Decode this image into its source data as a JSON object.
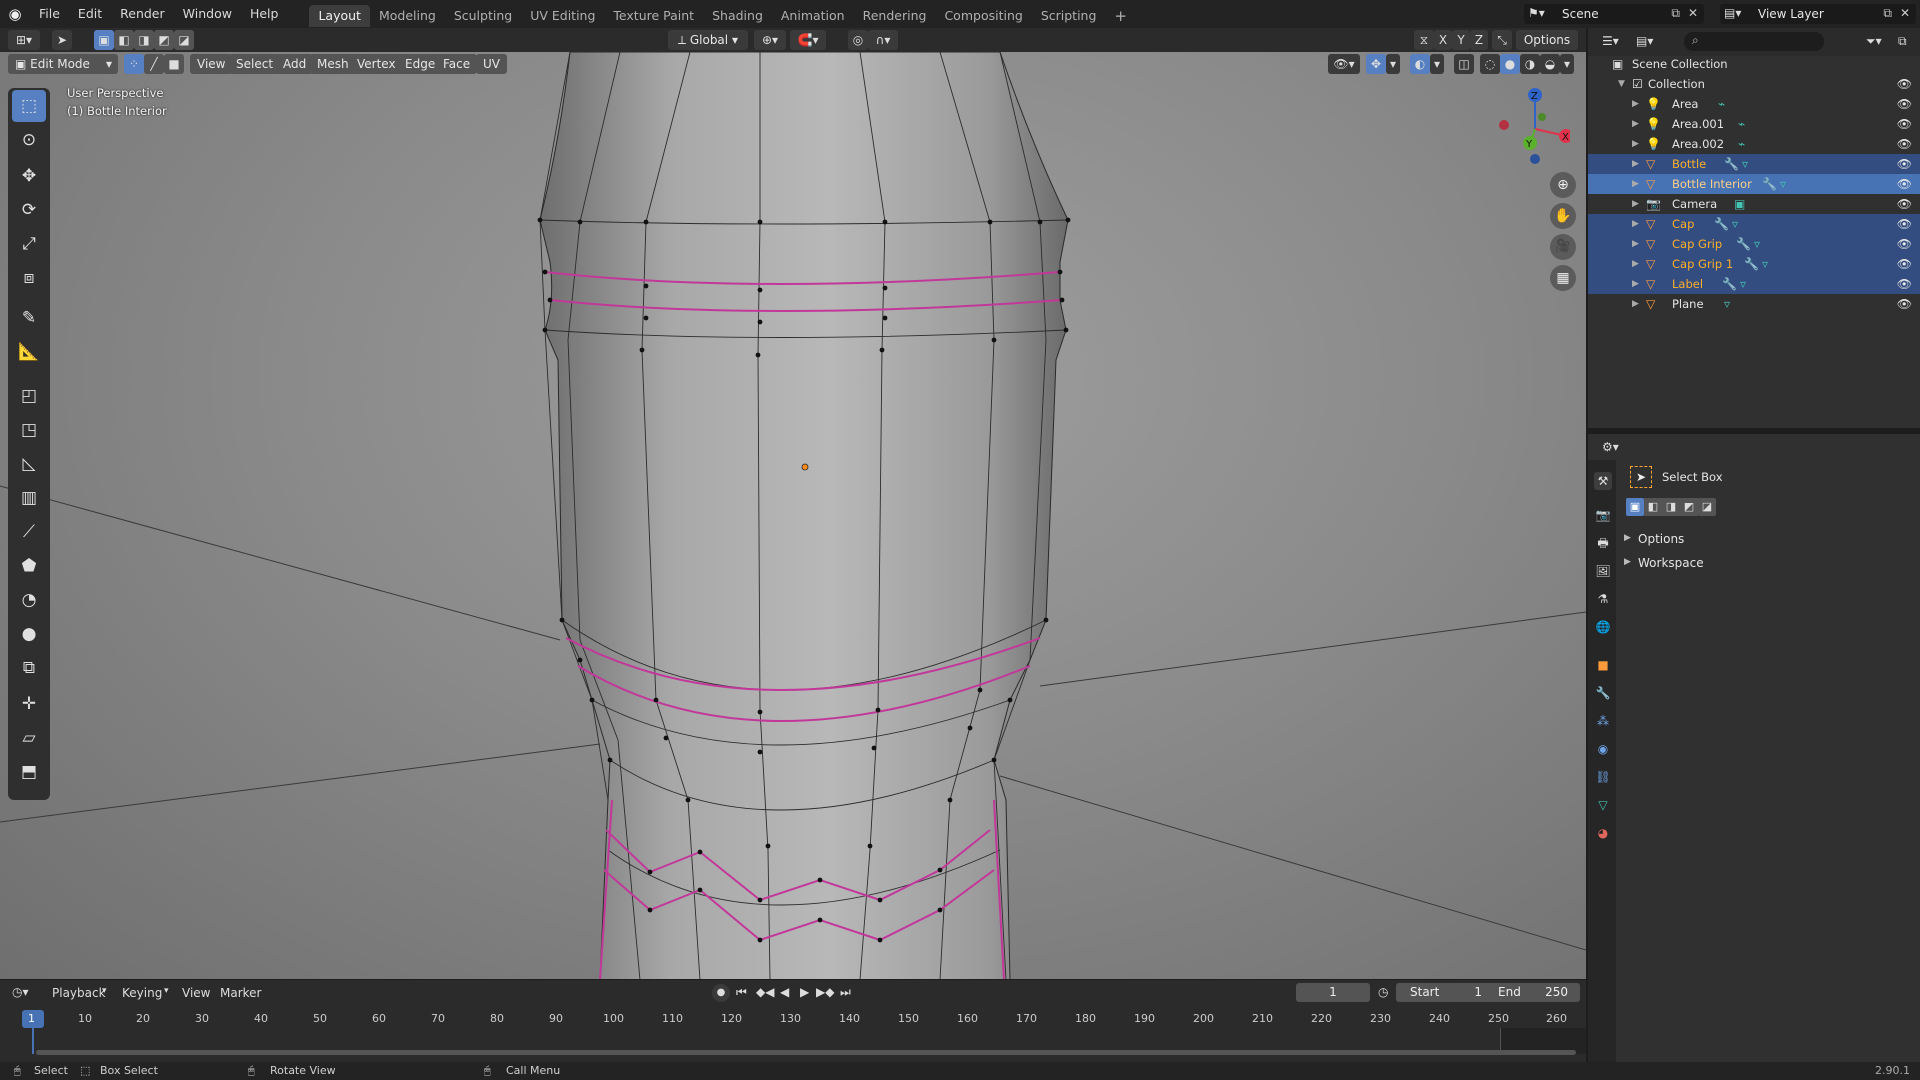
{
  "menu": {
    "items": [
      "File",
      "Edit",
      "Render",
      "Window",
      "Help"
    ],
    "workspaces": [
      "Layout",
      "Modeling",
      "Sculpting",
      "UV Editing",
      "Texture Paint",
      "Shading",
      "Animation",
      "Rendering",
      "Compositing",
      "Scripting"
    ],
    "active_workspace": "Layout",
    "add_tab": "+",
    "scene_label": "Scene",
    "view_layer_label": "View Layer"
  },
  "viewport_header": {
    "transform_orientation": "Global",
    "axes": [
      "X",
      "Y",
      "Z"
    ],
    "options_label": "Options"
  },
  "edit_header": {
    "mode": "Edit Mode",
    "menus": [
      "View",
      "Select",
      "Add",
      "Mesh",
      "Vertex",
      "Edge",
      "Face",
      "UV"
    ]
  },
  "viewport_info": {
    "line1": "User Perspective",
    "line2": "(1) Bottle Interior"
  },
  "gizmo": {
    "x": "X",
    "y": "Y",
    "z": "Z"
  },
  "toolbar_icons": [
    "select-box-icon",
    "cursor-icon",
    "move-icon",
    "rotate-icon",
    "scale-icon",
    "transform-icon",
    "annotate-icon",
    "measure-icon",
    "extrude-icon",
    "inset-icon",
    "bevel-icon",
    "loop-cut-icon",
    "knife-icon",
    "poly-build-icon",
    "spin-icon",
    "smooth-icon",
    "edge-slide-icon",
    "shrink-fatten-icon",
    "shear-icon",
    "rip-icon"
  ],
  "outliner": {
    "root": "Scene Collection",
    "collection": "Collection",
    "items": [
      {
        "name": "Area",
        "type": "light",
        "selected": false,
        "active": false
      },
      {
        "name": "Area.001",
        "type": "light",
        "selected": false,
        "active": false
      },
      {
        "name": "Area.002",
        "type": "light",
        "selected": false,
        "active": false
      },
      {
        "name": "Bottle",
        "type": "mesh",
        "selected": true,
        "active": false
      },
      {
        "name": "Bottle Interior",
        "type": "mesh",
        "selected": true,
        "active": true
      },
      {
        "name": "Camera",
        "type": "camera",
        "selected": false,
        "active": false
      },
      {
        "name": "Cap",
        "type": "mesh",
        "selected": true,
        "active": false
      },
      {
        "name": "Cap Grip",
        "type": "mesh",
        "selected": true,
        "active": false
      },
      {
        "name": "Cap Grip 1",
        "type": "mesh",
        "selected": true,
        "active": false
      },
      {
        "name": "Label",
        "type": "mesh",
        "selected": true,
        "active": false
      },
      {
        "name": "Plane",
        "type": "mesh",
        "selected": false,
        "active": false
      }
    ]
  },
  "properties": {
    "tool_name": "Select Box",
    "panels": [
      "Options",
      "Workspace"
    ]
  },
  "timeline": {
    "menus": [
      "Playback",
      "Keying",
      "View",
      "Marker"
    ],
    "current_frame": "1",
    "start_label": "Start",
    "start_value": "1",
    "end_label": "End",
    "end_value": "250",
    "ruler": [
      "1",
      "10",
      "20",
      "30",
      "40",
      "50",
      "60",
      "70",
      "80",
      "90",
      "100",
      "110",
      "120",
      "130",
      "140",
      "150",
      "160",
      "170",
      "180",
      "190",
      "200",
      "210",
      "220",
      "230",
      "240",
      "250",
      "260"
    ]
  },
  "statusbar": {
    "select": "Select",
    "box_select": "Box Select",
    "rotate_view": "Rotate View",
    "call_menu": "Call Menu",
    "version": "2.90.1"
  },
  "colors": {
    "accent": "#4772b3",
    "selected_row": "#334d80",
    "seam": "#c2389a",
    "object_orange": "#ffaf29"
  }
}
